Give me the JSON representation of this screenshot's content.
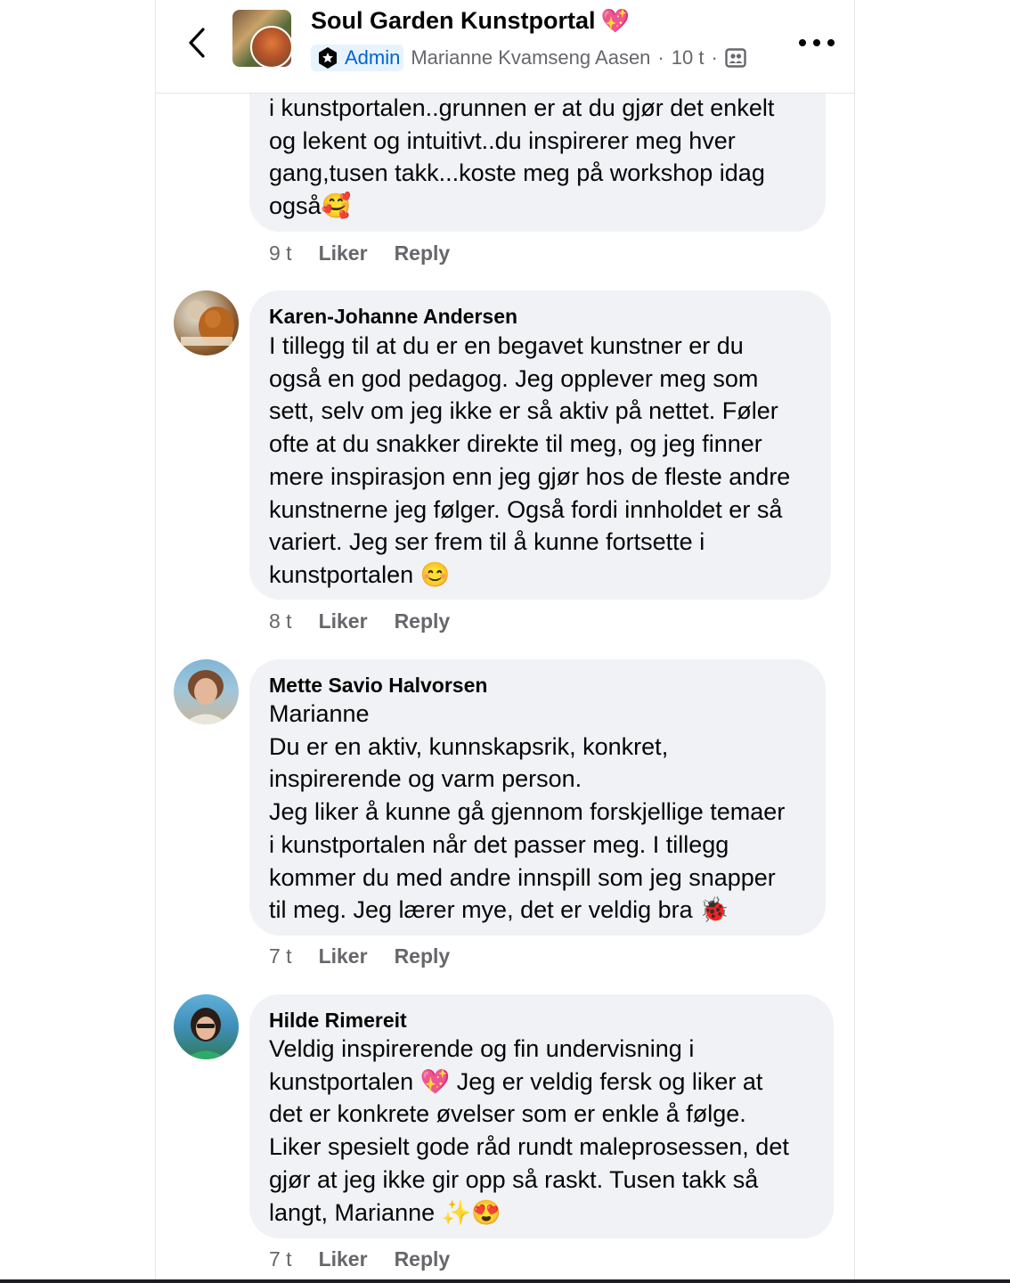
{
  "header": {
    "group_name": "Soul Garden Kunstportal",
    "group_name_emoji": "💖",
    "admin_label": "Admin",
    "author": "Marianne Kvamseng Aasen",
    "time": "10 t",
    "separator": "·",
    "icons": {
      "back": "chevron-left-icon",
      "badge": "admin-shield-icon",
      "audience": "group-audience-icon",
      "more": "more-dots-icon"
    }
  },
  "comments": [
    {
      "author": "",
      "lines": [
        "i kunstportalen..grunnen er at du gjør det enkelt",
        "og lekent og intuitivt..du inspirerer meg hver",
        "gang,tusen takk...koste meg på workshop idag",
        "også🥰"
      ],
      "time": "9 t",
      "like_label": "Liker",
      "reply_label": "Reply"
    },
    {
      "author": "Karen-Johanne Andersen",
      "lines": [
        "I tillegg til at du er en begavet kunstner er du",
        "også en god pedagog. Jeg opplever meg som",
        "sett, selv om jeg ikke er så aktiv på nettet. Føler",
        "ofte at du snakker direkte til meg, og jeg finner",
        "mere inspirasjon enn jeg gjør hos de fleste andre",
        "kunstnerne jeg følger. Også fordi innholdet er så",
        "variert. Jeg ser frem til å kunne fortsette i",
        "kunstportalen 😊"
      ],
      "time": "8 t",
      "like_label": "Liker",
      "reply_label": "Reply"
    },
    {
      "author": "Mette Savio Halvorsen",
      "lines": [
        "Marianne",
        "Du er en aktiv, kunnskapsrik, konkret,",
        "inspirerende og varm person.",
        "Jeg liker å kunne gå gjennom forskjellige temaer",
        "i kunstportalen når det passer meg. I tillegg",
        "kommer du med andre innspill som jeg snapper",
        "til meg. Jeg lærer mye, det er veldig bra 🐞"
      ],
      "time": "7 t",
      "like_label": "Liker",
      "reply_label": "Reply"
    },
    {
      "author": "Hilde Rimereit",
      "lines": [
        "Veldig inspirerende og fin undervisning i",
        "kunstportalen 💖 Jeg er veldig fersk og liker at",
        "det er konkrete øvelser som er enkle å følge.",
        "Liker spesielt gode råd rundt maleprosessen, det",
        "gjør at jeg ikke gir opp så raskt. Tusen takk så",
        "langt, Marianne ✨😍"
      ],
      "time": "7 t",
      "like_label": "Liker",
      "reply_label": "Reply"
    }
  ]
}
